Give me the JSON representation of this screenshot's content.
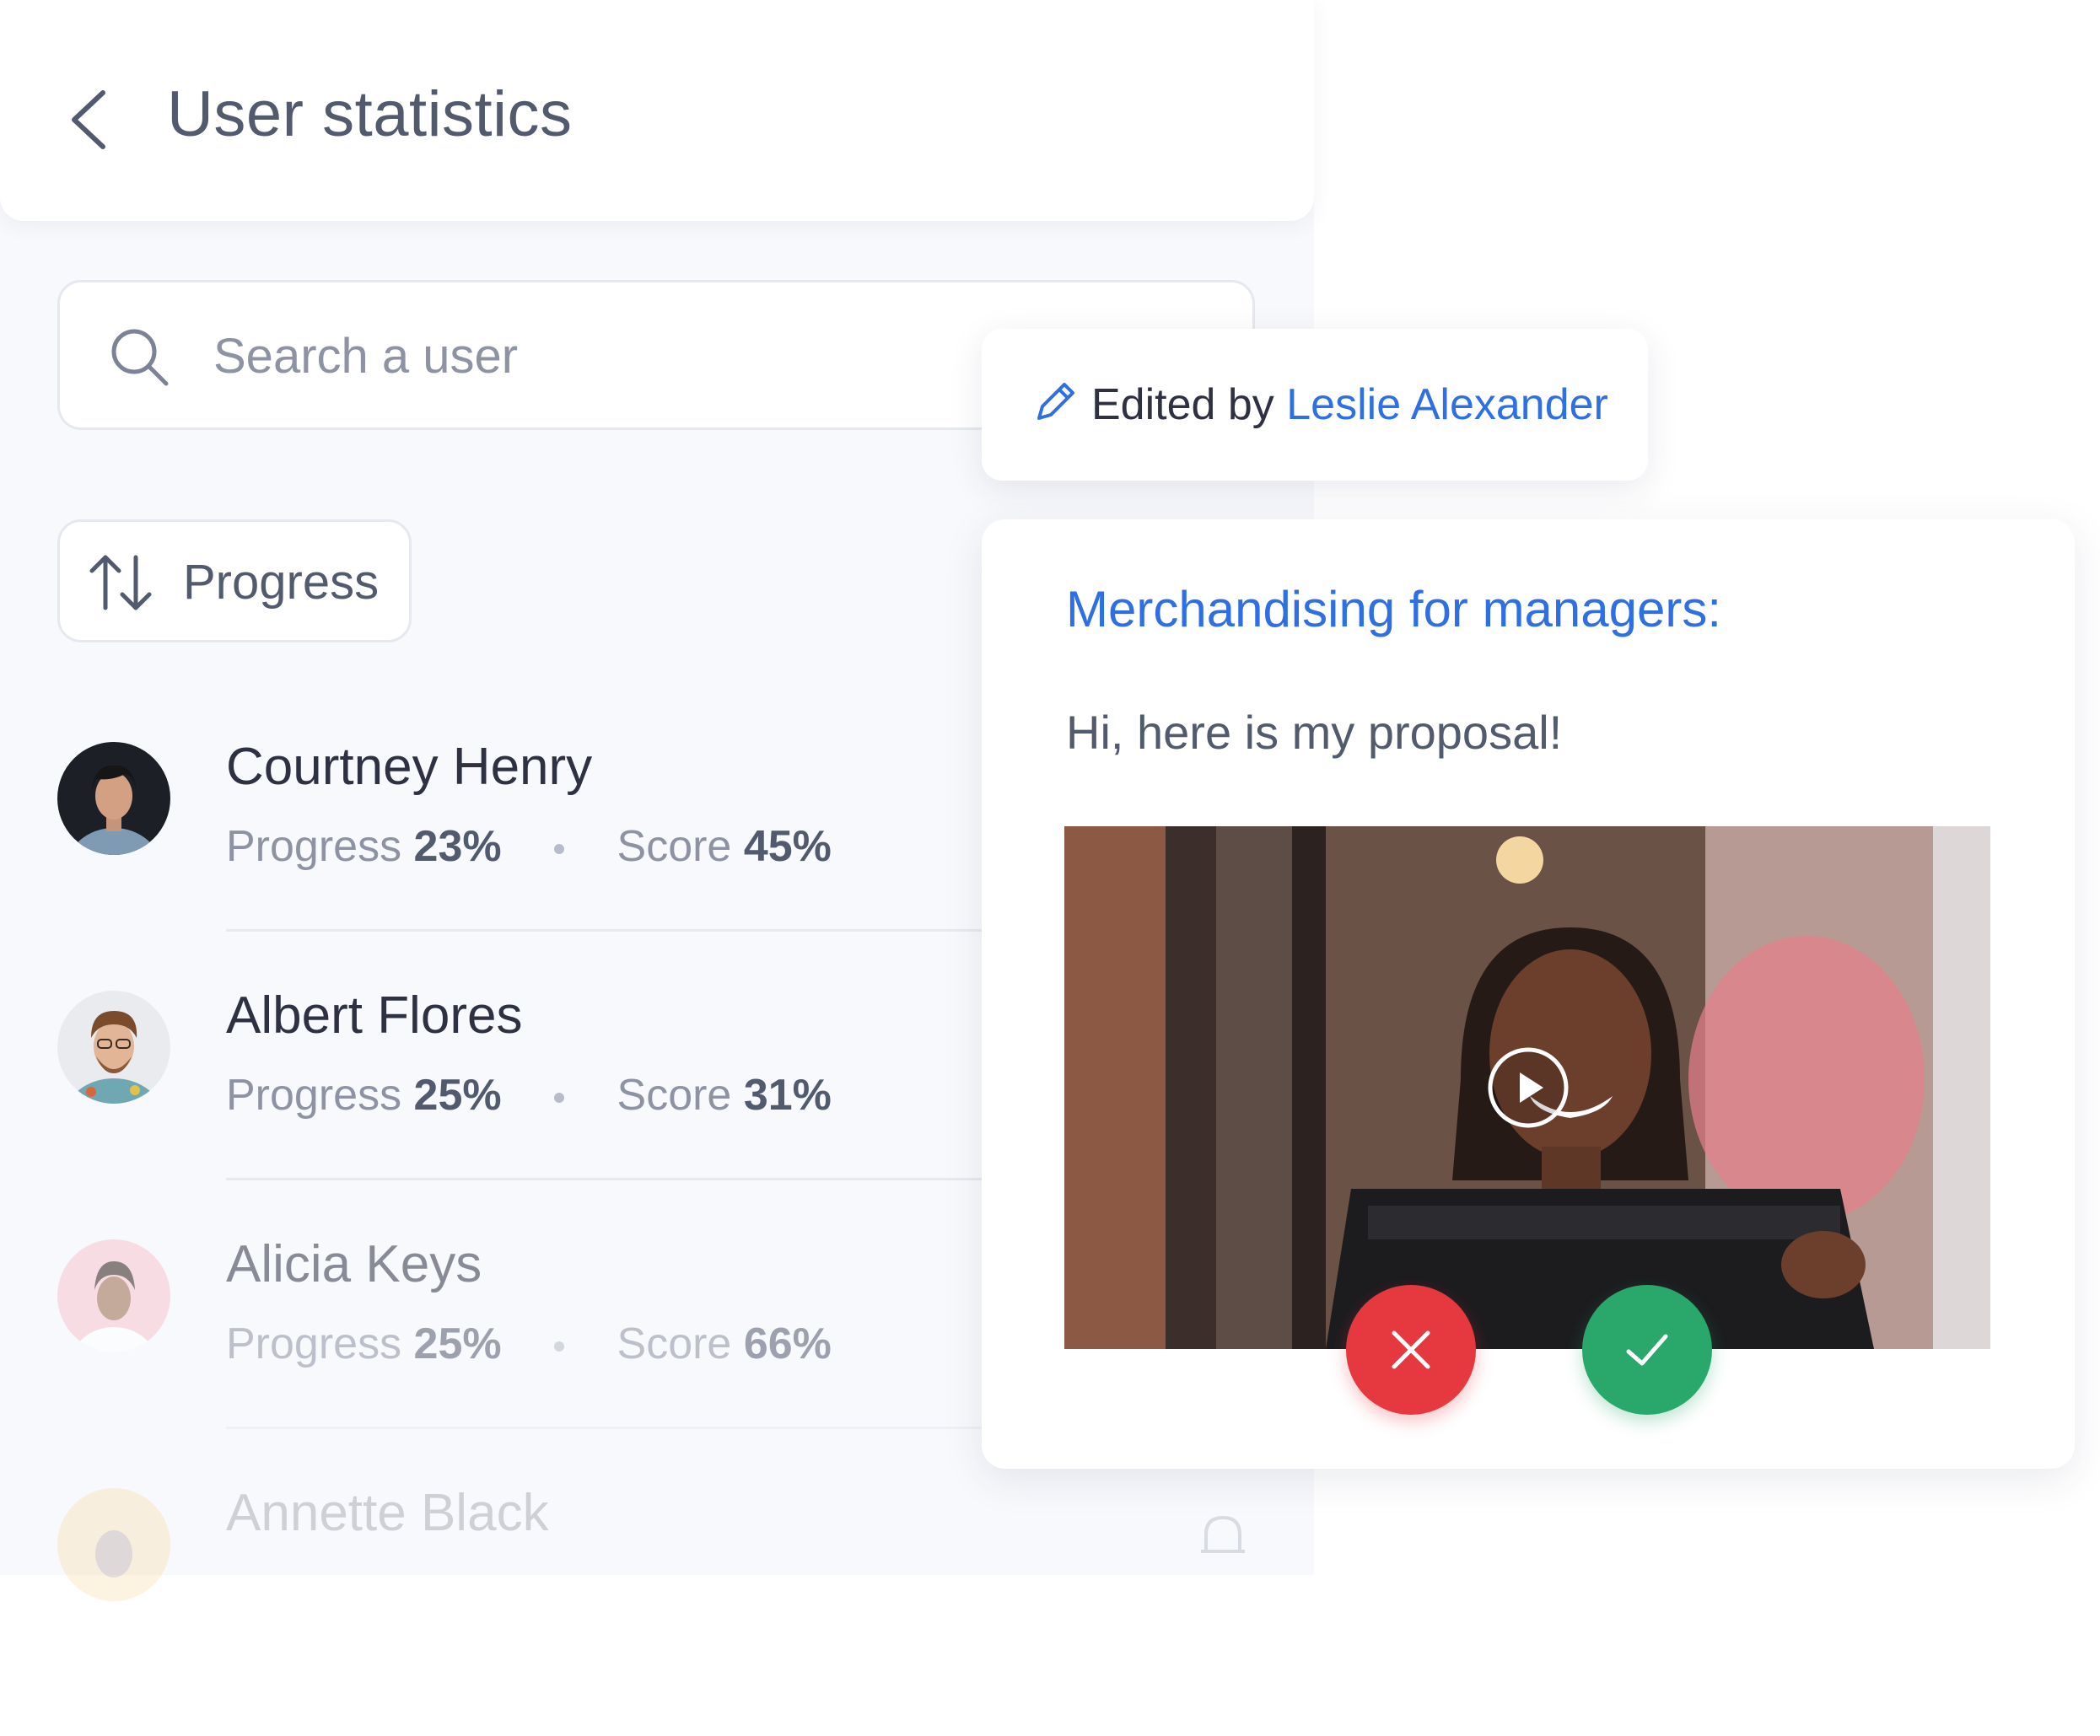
{
  "header": {
    "back_icon": "chevron-left-icon",
    "title": "User statistics"
  },
  "search": {
    "icon": "search-icon",
    "placeholder": "Search a user",
    "value": ""
  },
  "sort": {
    "icon": "sort-arrows-icon",
    "label": "Progress"
  },
  "users": [
    {
      "name": "Courtney Henry",
      "progress_label": "Progress",
      "progress": "23%",
      "score_label": "Score",
      "score": "45%"
    },
    {
      "name": "Albert Flores",
      "progress_label": "Progress",
      "progress": "25%",
      "score_label": "Score",
      "score": "31%"
    },
    {
      "name": "Alicia Keys",
      "progress_label": "Progress",
      "progress": "25%",
      "score_label": "Score",
      "score": "66%"
    },
    {
      "name": "Annette Black"
    }
  ],
  "edit_note": {
    "icon": "pencil-icon",
    "prefix": "Edited by",
    "editor": "Leslie Alexander"
  },
  "proposal": {
    "title": "Merchandising for managers:",
    "message": "Hi, here is my proposal!",
    "play_icon": "play-icon",
    "reject_icon": "close-icon",
    "approve_icon": "check-icon"
  },
  "colors": {
    "accent": "#2f6fe4",
    "reject": "#e5393f",
    "approve": "#2aa76b"
  }
}
